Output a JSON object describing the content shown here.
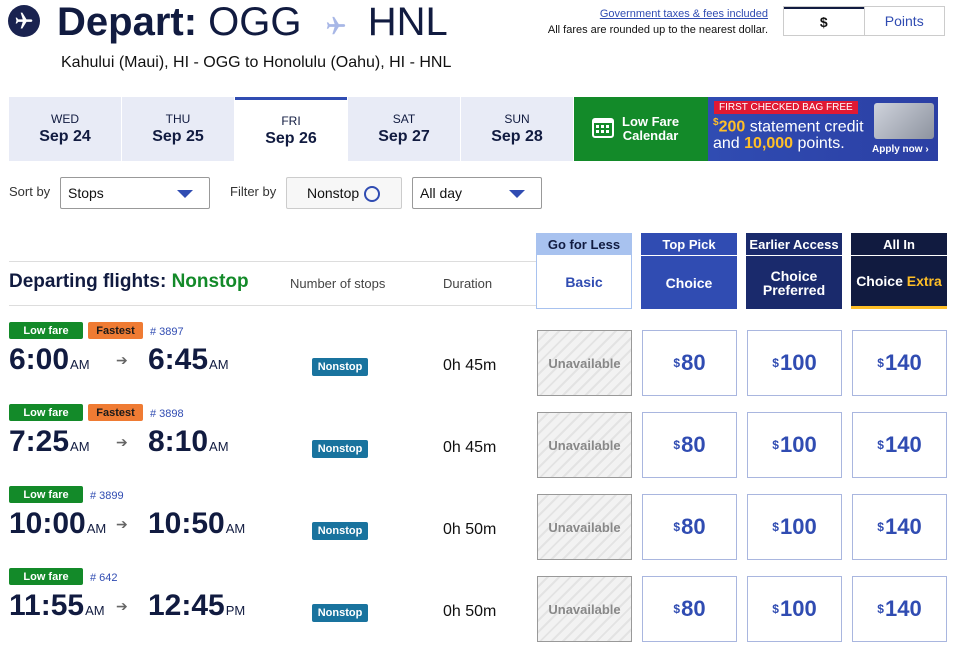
{
  "header": {
    "depart_label": "Depart:",
    "origin": "OGG",
    "destination": "HNL",
    "route": "Kahului (Maui), HI - OGG to Honolulu (Oahu), HI - HNL",
    "tax_link": "Government taxes & fees included",
    "tax_note": "All fares are rounded up to the nearest dollar.",
    "currency_dollar": "$",
    "currency_points": "Points"
  },
  "dates": [
    {
      "dow": "WED",
      "date": "Sep 24",
      "active": false
    },
    {
      "dow": "THU",
      "date": "Sep 25",
      "active": false
    },
    {
      "dow": "FRI",
      "date": "Sep 26",
      "active": true
    },
    {
      "dow": "SAT",
      "date": "Sep 27",
      "active": false
    },
    {
      "dow": "SUN",
      "date": "Sep 28",
      "active": false
    }
  ],
  "low_fare_calendar": {
    "line1": "Low Fare",
    "line2": "Calendar"
  },
  "promo": {
    "badge": "FIRST CHECKED BAG FREE",
    "dollar_sign": "$",
    "amount": "200",
    "line1_rest": " statement credit",
    "line2_pre": "and ",
    "points": "10,000",
    "line2_post": " points.",
    "apply": "Apply now"
  },
  "controls": {
    "sort_label": "Sort by",
    "sort_value": "Stops",
    "filter_label": "Filter by",
    "nonstop_label": "Nonstop",
    "time_value": "All day"
  },
  "list_header": {
    "departing_label": "Departing flights:",
    "departing_filter": "Nonstop",
    "stops_col": "Number of stops",
    "duration_col": "Duration"
  },
  "fare_classes": [
    {
      "tag": "Go for Less",
      "name": "Basic",
      "name2": "",
      "extra": ""
    },
    {
      "tag": "Top Pick",
      "name": "Choice",
      "name2": "",
      "extra": ""
    },
    {
      "tag": "Earlier Access",
      "name": "Choice",
      "name2": "Preferred",
      "extra": ""
    },
    {
      "tag": "All In",
      "name": "Choice",
      "name2": "",
      "extra": "Extra"
    }
  ],
  "flights": [
    {
      "badges": [
        "Low fare",
        "Fastest"
      ],
      "flight_no": "# 3897",
      "dep": "6:00",
      "dep_ampm": "AM",
      "arr": "6:45",
      "arr_ampm": "AM",
      "stops": "Nonstop",
      "duration": "0h 45m",
      "basic": "Unavailable",
      "choice": "80",
      "preferred": "100",
      "extra": "140"
    },
    {
      "badges": [
        "Low fare",
        "Fastest"
      ],
      "flight_no": "# 3898",
      "dep": "7:25",
      "dep_ampm": "AM",
      "arr": "8:10",
      "arr_ampm": "AM",
      "stops": "Nonstop",
      "duration": "0h 45m",
      "basic": "Unavailable",
      "choice": "80",
      "preferred": "100",
      "extra": "140"
    },
    {
      "badges": [
        "Low fare"
      ],
      "flight_no": "# 3899",
      "dep": "10:00",
      "dep_ampm": "AM",
      "arr": "10:50",
      "arr_ampm": "AM",
      "stops": "Nonstop",
      "duration": "0h 50m",
      "basic": "Unavailable",
      "choice": "80",
      "preferred": "100",
      "extra": "140"
    },
    {
      "badges": [
        "Low fare"
      ],
      "flight_no": "# 642",
      "dep": "11:55",
      "dep_ampm": "AM",
      "arr": "12:45",
      "arr_ampm": "PM",
      "stops": "Nonstop",
      "duration": "0h 50m",
      "basic": "Unavailable",
      "choice": "80",
      "preferred": "100",
      "extra": "140"
    }
  ],
  "colors": {
    "navy": "#111b40",
    "brand_blue": "#304cb2",
    "green": "#138a29",
    "orange": "#ef7b33",
    "basic_tag": "#a8c2ef",
    "choice_tag": "#304cb2",
    "preferred_tag": "#1a2a6c",
    "extra_tag": "#111b40",
    "gold": "#ffbf27"
  },
  "currency_symbol": "$"
}
